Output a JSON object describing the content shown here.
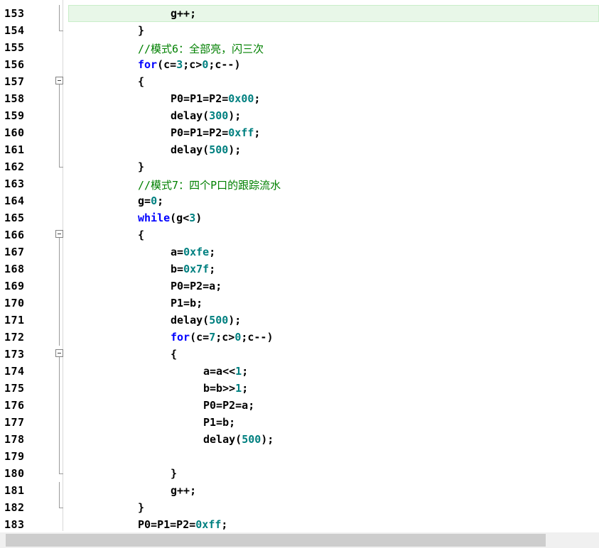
{
  "editor": {
    "lines": [
      {
        "n": "153",
        "fold": "line",
        "hl": true,
        "indent": 2,
        "segs": [
          {
            "t": "g++;",
            "c": ""
          }
        ]
      },
      {
        "n": "154",
        "fold": "end",
        "indent": 1,
        "segs": [
          {
            "t": "}",
            "c": ""
          }
        ]
      },
      {
        "n": "155",
        "fold": "none",
        "indent": 1,
        "segs": [
          {
            "t": "//模式6：全部亮，闪三次",
            "c": "cm"
          }
        ]
      },
      {
        "n": "156",
        "fold": "none",
        "indent": 1,
        "segs": [
          {
            "t": "for",
            "c": "kw"
          },
          {
            "t": "(c=",
            "c": ""
          },
          {
            "t": "3",
            "c": "num"
          },
          {
            "t": ";c>",
            "c": ""
          },
          {
            "t": "0",
            "c": "num"
          },
          {
            "t": ";c--)",
            "c": ""
          }
        ]
      },
      {
        "n": "157",
        "fold": "box",
        "indent": 1,
        "segs": [
          {
            "t": "{",
            "c": ""
          }
        ]
      },
      {
        "n": "158",
        "fold": "line",
        "indent": 2,
        "segs": [
          {
            "t": "P0=P1=P2=",
            "c": ""
          },
          {
            "t": "0x00",
            "c": "num"
          },
          {
            "t": ";",
            "c": ""
          }
        ]
      },
      {
        "n": "159",
        "fold": "line",
        "indent": 2,
        "segs": [
          {
            "t": "delay(",
            "c": ""
          },
          {
            "t": "300",
            "c": "num"
          },
          {
            "t": ");",
            "c": ""
          }
        ]
      },
      {
        "n": "160",
        "fold": "line",
        "indent": 2,
        "segs": [
          {
            "t": "P0=P1=P2=",
            "c": ""
          },
          {
            "t": "0xff",
            "c": "num"
          },
          {
            "t": ";",
            "c": ""
          }
        ]
      },
      {
        "n": "161",
        "fold": "line",
        "indent": 2,
        "segs": [
          {
            "t": "delay(",
            "c": ""
          },
          {
            "t": "500",
            "c": "num"
          },
          {
            "t": ");",
            "c": ""
          }
        ]
      },
      {
        "n": "162",
        "fold": "end",
        "indent": 1,
        "segs": [
          {
            "t": "}",
            "c": ""
          }
        ]
      },
      {
        "n": "163",
        "fold": "none",
        "indent": 1,
        "segs": [
          {
            "t": "//模式7：四个P口的跟踪流水",
            "c": "cm"
          }
        ]
      },
      {
        "n": "164",
        "fold": "none",
        "indent": 1,
        "segs": [
          {
            "t": "g=",
            "c": ""
          },
          {
            "t": "0",
            "c": "num"
          },
          {
            "t": ";",
            "c": ""
          }
        ]
      },
      {
        "n": "165",
        "fold": "none",
        "indent": 1,
        "segs": [
          {
            "t": "while",
            "c": "kw"
          },
          {
            "t": "(g<",
            "c": ""
          },
          {
            "t": "3",
            "c": "num"
          },
          {
            "t": ")",
            "c": ""
          }
        ]
      },
      {
        "n": "166",
        "fold": "box",
        "indent": 1,
        "segs": [
          {
            "t": "{",
            "c": ""
          }
        ]
      },
      {
        "n": "167",
        "fold": "line",
        "indent": 2,
        "segs": [
          {
            "t": "a=",
            "c": ""
          },
          {
            "t": "0xfe",
            "c": "num"
          },
          {
            "t": ";",
            "c": ""
          }
        ]
      },
      {
        "n": "168",
        "fold": "line",
        "indent": 2,
        "segs": [
          {
            "t": "b=",
            "c": ""
          },
          {
            "t": "0x7f",
            "c": "num"
          },
          {
            "t": ";",
            "c": ""
          }
        ]
      },
      {
        "n": "169",
        "fold": "line",
        "indent": 2,
        "segs": [
          {
            "t": "P0=P2=a;",
            "c": ""
          }
        ]
      },
      {
        "n": "170",
        "fold": "line",
        "indent": 2,
        "segs": [
          {
            "t": "P1=b;",
            "c": ""
          }
        ]
      },
      {
        "n": "171",
        "fold": "line",
        "indent": 2,
        "segs": [
          {
            "t": "delay(",
            "c": ""
          },
          {
            "t": "500",
            "c": "num"
          },
          {
            "t": ");",
            "c": ""
          }
        ]
      },
      {
        "n": "172",
        "fold": "line",
        "indent": 2,
        "segs": [
          {
            "t": "for",
            "c": "kw"
          },
          {
            "t": "(c=",
            "c": ""
          },
          {
            "t": "7",
            "c": "num"
          },
          {
            "t": ";c>",
            "c": ""
          },
          {
            "t": "0",
            "c": "num"
          },
          {
            "t": ";c--)",
            "c": ""
          }
        ]
      },
      {
        "n": "173",
        "fold": "box",
        "indent": 2,
        "segs": [
          {
            "t": "{",
            "c": ""
          }
        ]
      },
      {
        "n": "174",
        "fold": "line",
        "indent": 3,
        "segs": [
          {
            "t": "a=a<<",
            "c": ""
          },
          {
            "t": "1",
            "c": "num"
          },
          {
            "t": ";",
            "c": ""
          }
        ]
      },
      {
        "n": "175",
        "fold": "line",
        "indent": 3,
        "segs": [
          {
            "t": "b=b>>",
            "c": ""
          },
          {
            "t": "1",
            "c": "num"
          },
          {
            "t": ";",
            "c": ""
          }
        ]
      },
      {
        "n": "176",
        "fold": "line",
        "indent": 3,
        "segs": [
          {
            "t": "P0=P2=a;",
            "c": ""
          }
        ]
      },
      {
        "n": "177",
        "fold": "line",
        "indent": 3,
        "segs": [
          {
            "t": "P1=b;",
            "c": ""
          }
        ]
      },
      {
        "n": "178",
        "fold": "line",
        "indent": 3,
        "segs": [
          {
            "t": "delay(",
            "c": ""
          },
          {
            "t": "500",
            "c": "num"
          },
          {
            "t": ");",
            "c": ""
          }
        ]
      },
      {
        "n": "179",
        "fold": "line",
        "indent": 3,
        "segs": []
      },
      {
        "n": "180",
        "fold": "end",
        "indent": 2,
        "segs": [
          {
            "t": "}",
            "c": ""
          }
        ]
      },
      {
        "n": "181",
        "fold": "line",
        "indent": 2,
        "segs": [
          {
            "t": "g++;",
            "c": ""
          }
        ]
      },
      {
        "n": "182",
        "fold": "end",
        "indent": 1,
        "segs": [
          {
            "t": "}",
            "c": ""
          }
        ]
      },
      {
        "n": "183",
        "fold": "none",
        "indent": 1,
        "segs": [
          {
            "t": "P0=P1=P2=",
            "c": ""
          },
          {
            "t": "0xff",
            "c": "num"
          },
          {
            "t": ";",
            "c": ""
          }
        ]
      }
    ]
  },
  "colors": {
    "keyword": "#0000ff",
    "number": "#008080",
    "comment": "#008000",
    "highlight": "#e8f7e8"
  }
}
